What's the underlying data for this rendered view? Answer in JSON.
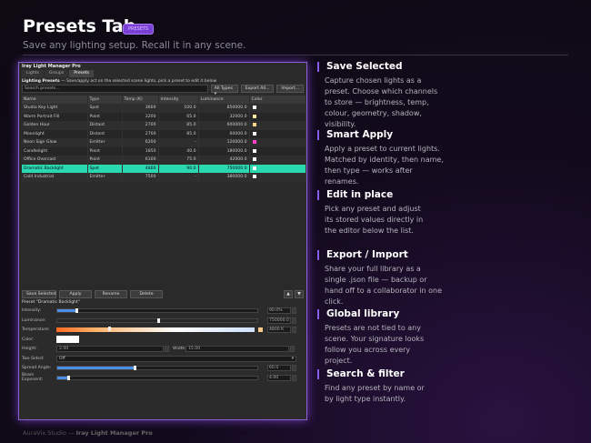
{
  "page": {
    "title": "Presets Tab",
    "badge": "PRESETS",
    "subtitle": "Save any lighting setup. Recall it in any scene.",
    "footer_brand": "AuraVix Studio",
    "footer_sep": "—",
    "footer_product": "Iray Light Manager Pro"
  },
  "window": {
    "title": "Iray Light Manager Pro",
    "tabs": [
      "Lights",
      "Groups",
      "Presets"
    ],
    "header_bold": "Lighting Presets",
    "header_text": "— Save/apply act on the selected scene lights, pick a preset to edit it below",
    "search_placeholder": "Search presets...",
    "filter_value": "All Types",
    "export_all": "Export All...",
    "import": "Import...",
    "columns": [
      "Name",
      "Type",
      "Temp (K)",
      "Intensity",
      "Luminance",
      "Color"
    ],
    "rows": [
      {
        "name": "Studio Key Light",
        "type": "Spot",
        "temp": "3600",
        "intensity": "100.0",
        "lum": "850000.0",
        "color": "#ffffff"
      },
      {
        "name": "Warm Portrait Fill",
        "type": "Point",
        "temp": "3200",
        "intensity": "65.0",
        "lum": "32000.0",
        "color": "#f5e6a6"
      },
      {
        "name": "Golden Hour",
        "type": "Distant",
        "temp": "2700",
        "intensity": "85.0",
        "lum": "600000.0",
        "color": "#f7d68a"
      },
      {
        "name": "Moonlight",
        "type": "Distant",
        "temp": "2700",
        "intensity": "85.0",
        "lum": "60000.0",
        "color": "#ffffff"
      },
      {
        "name": "Neon Sign Glow",
        "type": "Emitter",
        "temp": "6200",
        "intensity": "-",
        "lum": "120000.0",
        "color": "#ff40c8"
      },
      {
        "name": "Candlelight",
        "type": "Point",
        "temp": "1850",
        "intensity": "40.0",
        "lum": "180000.0",
        "color": "#ffffff"
      },
      {
        "name": "Office Overcast",
        "type": "Point",
        "temp": "6100",
        "intensity": "75.0",
        "lum": "42000.0",
        "color": "#ffffff"
      },
      {
        "name": "Dramatic Backlight",
        "type": "Spot",
        "temp": "4800",
        "intensity": "90.0",
        "lum": "750000.0",
        "color": "#ffffff",
        "selected": true
      },
      {
        "name": "Cold Industrial",
        "type": "Emitter",
        "temp": "7500",
        "intensity": "-",
        "lum": "380000.0",
        "color": "#ffffff"
      }
    ],
    "actions": [
      "Save Selected",
      "Apply",
      "Rename",
      "Delete"
    ],
    "arrow_up": "▲",
    "arrow_down": "▼",
    "preset_label": "Preset \"Dramatic Backlight\"",
    "props": {
      "intensity_label": "Intensity:",
      "intensity_value": "90.0%",
      "intensity_level": 0.9,
      "luminance_label": "Luminance:",
      "luminance_value": "750000.0",
      "temperature_label": "Temperature:",
      "temperature_value": "4800 K",
      "color_label": "Color:",
      "height_label": "Height:",
      "height_value": "2.00",
      "width_label": "Width:",
      "width_value": "15.00",
      "twosided_label": "Two Sided:",
      "twosided_value": "Off",
      "spread_label": "Spread Angle:",
      "spread_value": "60.0",
      "beam_label": "Beam Exponent:",
      "beam_value": "4.00"
    }
  },
  "features": [
    {
      "title": "Save Selected",
      "body": "Capture chosen lights as a preset. Choose which channels to store — brightness, temp, colour, geometry, shadow, visibility."
    },
    {
      "title": "Smart Apply",
      "body": "Apply a preset to current lights. Matched by identity, then name, then type — works after renames."
    },
    {
      "title": "Edit in place",
      "body": "Pick any preset and adjust its stored values directly in the editor below the list."
    },
    {
      "title": "Export / Import",
      "body": "Share your full library as a single .json file — backup or hand off to a collaborator in one click."
    },
    {
      "title": "Global library",
      "body": "Presets are not tied to any scene. Your signature looks follow you across every project."
    },
    {
      "title": "Search & filter",
      "body": "Find any preset by name or by light type instantly."
    }
  ]
}
